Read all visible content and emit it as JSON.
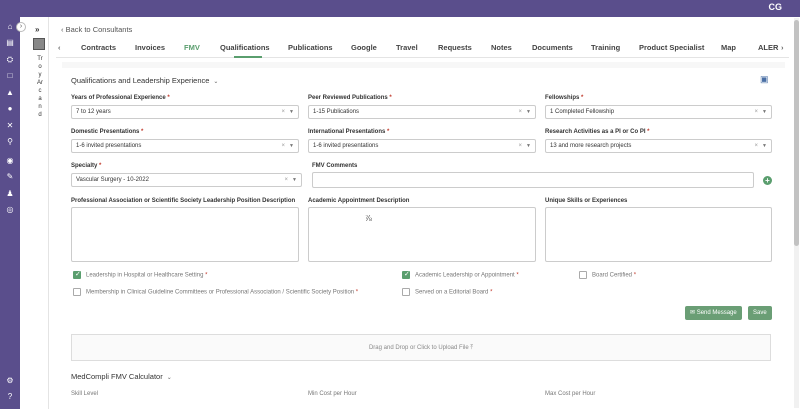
{
  "header": {
    "user_initials": "CG"
  },
  "profile": {
    "name_vertical": "Troy Arcand"
  },
  "nav": {
    "back_label": "Back to Consultants"
  },
  "tabs": [
    {
      "label": "Contracts"
    },
    {
      "label": "Invoices"
    },
    {
      "label": "FMV"
    },
    {
      "label": "Qualifications"
    },
    {
      "label": "Publications"
    },
    {
      "label": "Google"
    },
    {
      "label": "Travel"
    },
    {
      "label": "Requests"
    },
    {
      "label": "Notes"
    },
    {
      "label": "Documents"
    },
    {
      "label": "Training"
    },
    {
      "label": "Product Specialist"
    },
    {
      "label": "Map"
    },
    {
      "label": "ALER"
    }
  ],
  "active_tab": "FMV",
  "section": {
    "title": "Qualifications and Leadership Experience"
  },
  "fields": {
    "years_experience": {
      "label": "Years of Professional Experience",
      "value": "7 to 12 years"
    },
    "peer_reviewed": {
      "label": "Peer Reviewed Publications",
      "value": "1-15 Publications"
    },
    "fellowships": {
      "label": "Fellowships",
      "value": "1 Completed Fellowship"
    },
    "domestic_presentations": {
      "label": "Domestic Presentations",
      "value": "1-6 invited presentations"
    },
    "international_presentations": {
      "label": "International Presentations",
      "value": "1-6 invited presentations"
    },
    "research_activities": {
      "label": "Research Activities as a PI or Co PI",
      "value": "13 and more research projects"
    },
    "specialty": {
      "label": "Specialty",
      "value": "Vascular Surgery - 10-2022"
    },
    "fmv_comments": {
      "label": "FMV Comments",
      "value": ""
    },
    "prof_association": {
      "label": "Professional Association or Scientific Society Leadership Position Description"
    },
    "academic_appointment": {
      "label": "Academic Appointment Description"
    },
    "unique_skills": {
      "label": "Unique Skills or Experiences"
    }
  },
  "required_marker": "*",
  "checkboxes": {
    "leadership_hospital": {
      "label": "Leadership in Hospital or Healthcare Setting",
      "checked": true
    },
    "academic_leadership": {
      "label": "Academic Leadership or Appointment",
      "checked": true
    },
    "board_certified": {
      "label": "Board Certified",
      "checked": false
    },
    "membership_committees": {
      "label": "Membership in Clinical Guideline Committees or Professional Association / Scientific Society Position",
      "checked": false
    },
    "editorial_board": {
      "label": "Served on a Editorial Board",
      "checked": false
    }
  },
  "buttons": {
    "send_message": "Send Message",
    "save": "Save"
  },
  "upload": {
    "label": "Drag and Drop or Click to Upload File"
  },
  "calculator": {
    "title": "MedCompli FMV Calculator",
    "skill_level": "Skill Level",
    "min_cost": "Min Cost per Hour",
    "max_cost": "Max Cost per Hour"
  },
  "colors": {
    "sidebar": "#5a4e8c",
    "accent_green": "#5a9e6e",
    "required": "#c0392b"
  }
}
